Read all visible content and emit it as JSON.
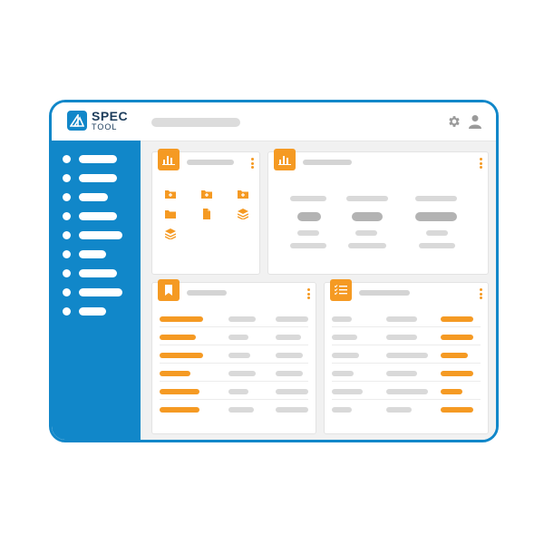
{
  "app": {
    "logo_main": "SPEC",
    "logo_sub": "TOOL"
  },
  "icons": {
    "logo": "spec-tool-logo-icon",
    "gear": "gear-icon",
    "user": "user-icon",
    "chart": "bar-chart-icon",
    "bookmark": "bookmark-icon",
    "checklist": "checklist-icon",
    "folder_plus": "folder-plus-icon",
    "folder": "folder-icon",
    "file": "file-icon",
    "layers": "layers-icon"
  },
  "colors": {
    "brand_blue": "#1187c9",
    "accent_orange": "#f59a23",
    "placeholder_gray": "#d9d9d9"
  },
  "sidebar": {
    "item_count": 9
  }
}
